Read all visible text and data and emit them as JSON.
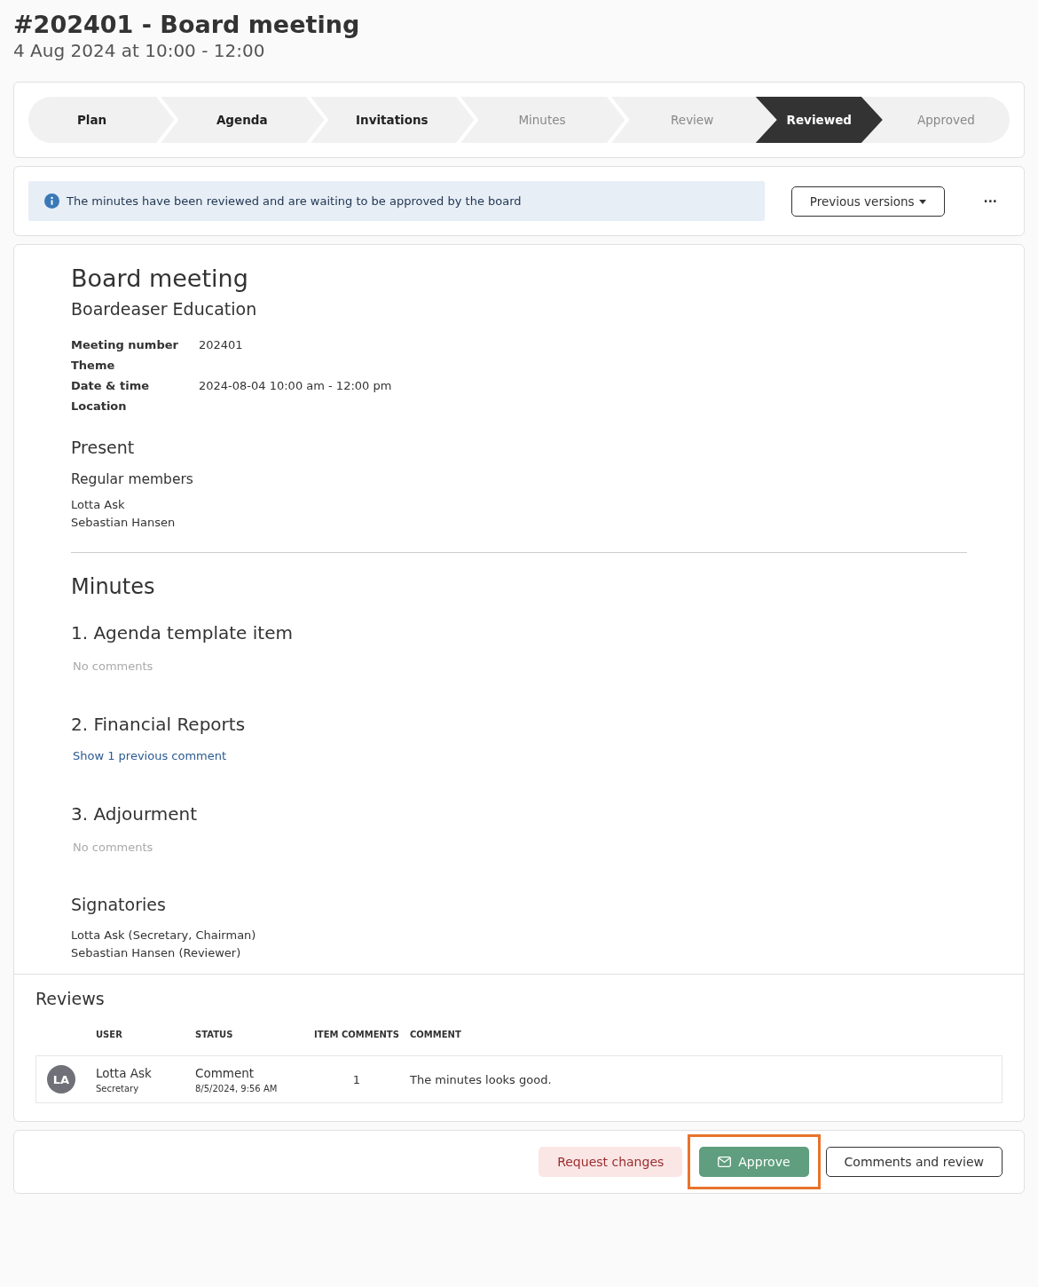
{
  "header": {
    "title": "#202401 - Board meeting",
    "subtitle": "4 Aug 2024 at 10:00 - 12:00"
  },
  "steps": [
    {
      "label": "Plan",
      "selected": false,
      "dimmed": false
    },
    {
      "label": "Agenda",
      "selected": false,
      "dimmed": false
    },
    {
      "label": "Invitations",
      "selected": false,
      "dimmed": false
    },
    {
      "label": "Minutes",
      "selected": false,
      "dimmed": true
    },
    {
      "label": "Review",
      "selected": false,
      "dimmed": true
    },
    {
      "label": "Reviewed",
      "selected": true,
      "dimmed": false
    },
    {
      "label": "Approved",
      "selected": false,
      "dimmed": true
    }
  ],
  "notice": {
    "text": "The minutes have been reviewed and are waiting to be approved by the board",
    "versions_button": "Previous versions",
    "more_button": "···"
  },
  "document": {
    "title": "Board meeting",
    "organization": "Boardeaser Education",
    "fields": [
      {
        "label": "Meeting number",
        "value": "202401"
      },
      {
        "label": "Theme"
      },
      {
        "label": "Date & time",
        "value": "2024-08-04 10:00 am - 12:00 pm"
      },
      {
        "label": "Location"
      }
    ],
    "present_heading": "Present",
    "members_heading": "Regular members",
    "members": [
      "Lotta Ask",
      "Sebastian Hansen"
    ],
    "minutes_heading": "Minutes",
    "items": [
      {
        "title": "1. Agenda template item",
        "kind": "empty",
        "note": "No comments"
      },
      {
        "title": "2. Financial Reports",
        "kind": "link",
        "note": "Show 1 previous comment"
      },
      {
        "title": "3. Adjourment",
        "kind": "empty",
        "note": "No comments"
      }
    ],
    "signatories_heading": "Signatories",
    "signatories": [
      "Lotta Ask (Secretary, Chairman)",
      "Sebastian Hansen (Reviewer)"
    ]
  },
  "reviews": {
    "heading": "Reviews",
    "columns": [
      "USER",
      "STATUS",
      "ITEM COMMENTS",
      "COMMENT"
    ],
    "rows": [
      {
        "initials": "LA",
        "name": "Lotta Ask",
        "role": "Secretary",
        "status": "Comment",
        "date": "8/5/2024, 9:56 AM",
        "item_comments": "1",
        "comment": "The minutes looks good."
      }
    ]
  },
  "actions": [
    {
      "label": "Request changes",
      "kind": "danger",
      "highlighted": false
    },
    {
      "label": "Approve",
      "kind": "primary",
      "highlighted": true
    },
    {
      "label": "Comments and review",
      "kind": "outline",
      "highlighted": false
    }
  ]
}
